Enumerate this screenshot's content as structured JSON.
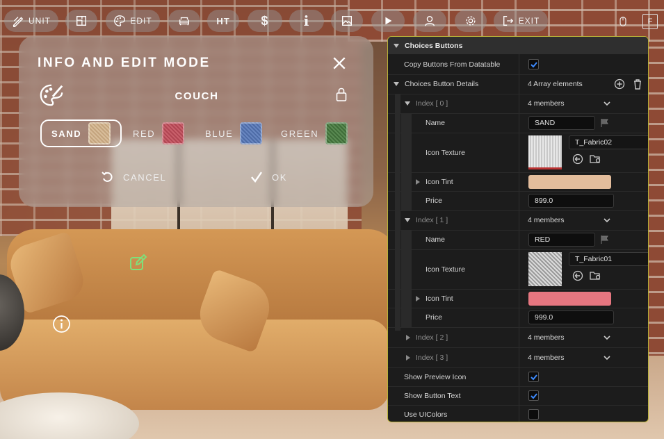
{
  "toolbar": {
    "unit_label": "UNIT",
    "edit_label": "EDIT",
    "exit_label": "EXIT",
    "dollar_glyph": "$",
    "info_glyph": "i",
    "ht_glyph": "HT",
    "f_key": "F"
  },
  "info_panel": {
    "title": "INFO AND EDIT MODE",
    "object_name": "COUCH",
    "choices": [
      {
        "label": "SAND",
        "color": "#c9ab88",
        "selected": true
      },
      {
        "label": "RED",
        "color": "#c0515e",
        "selected": false
      },
      {
        "label": "BLUE",
        "color": "#5a79b4",
        "selected": false
      },
      {
        "label": "GREEN",
        "color": "#4d7e45",
        "selected": false
      }
    ],
    "cancel_label": "CANCEL",
    "ok_label": "OK"
  },
  "details": {
    "section_title": "Choices Buttons",
    "copy_buttons_label": "Copy Buttons From Datatable",
    "choice_details_label": "Choices Button Details",
    "array_count": "4 Array elements",
    "index0": {
      "label": "Index [ 0 ]",
      "members": "4 members",
      "name_label": "Name",
      "name_value": "SAND",
      "texture_label": "Icon Texture",
      "texture_value": "T_Fabric02",
      "tint_label": "Icon Tint",
      "tint_color": "#e3bd9c",
      "price_label": "Price",
      "price_value": "899.0"
    },
    "index1": {
      "label": "Index [ 1 ]",
      "members": "4 members",
      "name_label": "Name",
      "name_value": "RED",
      "texture_label": "Icon Texture",
      "texture_value": "T_Fabric01",
      "tint_label": "Icon Tint",
      "tint_color": "#e67680",
      "price_label": "Price",
      "price_value": "999.0"
    },
    "index2": {
      "label": "Index [ 2 ]",
      "members": "4 members"
    },
    "index3": {
      "label": "Index [ 3 ]",
      "members": "4 members"
    },
    "show_preview_icon_label": "Show Preview Icon",
    "show_button_text_label": "Show Button Text",
    "use_uicolors_label": "Use UIColors",
    "accent_check": "#3d8bff",
    "panel_border": "#b8b238"
  }
}
